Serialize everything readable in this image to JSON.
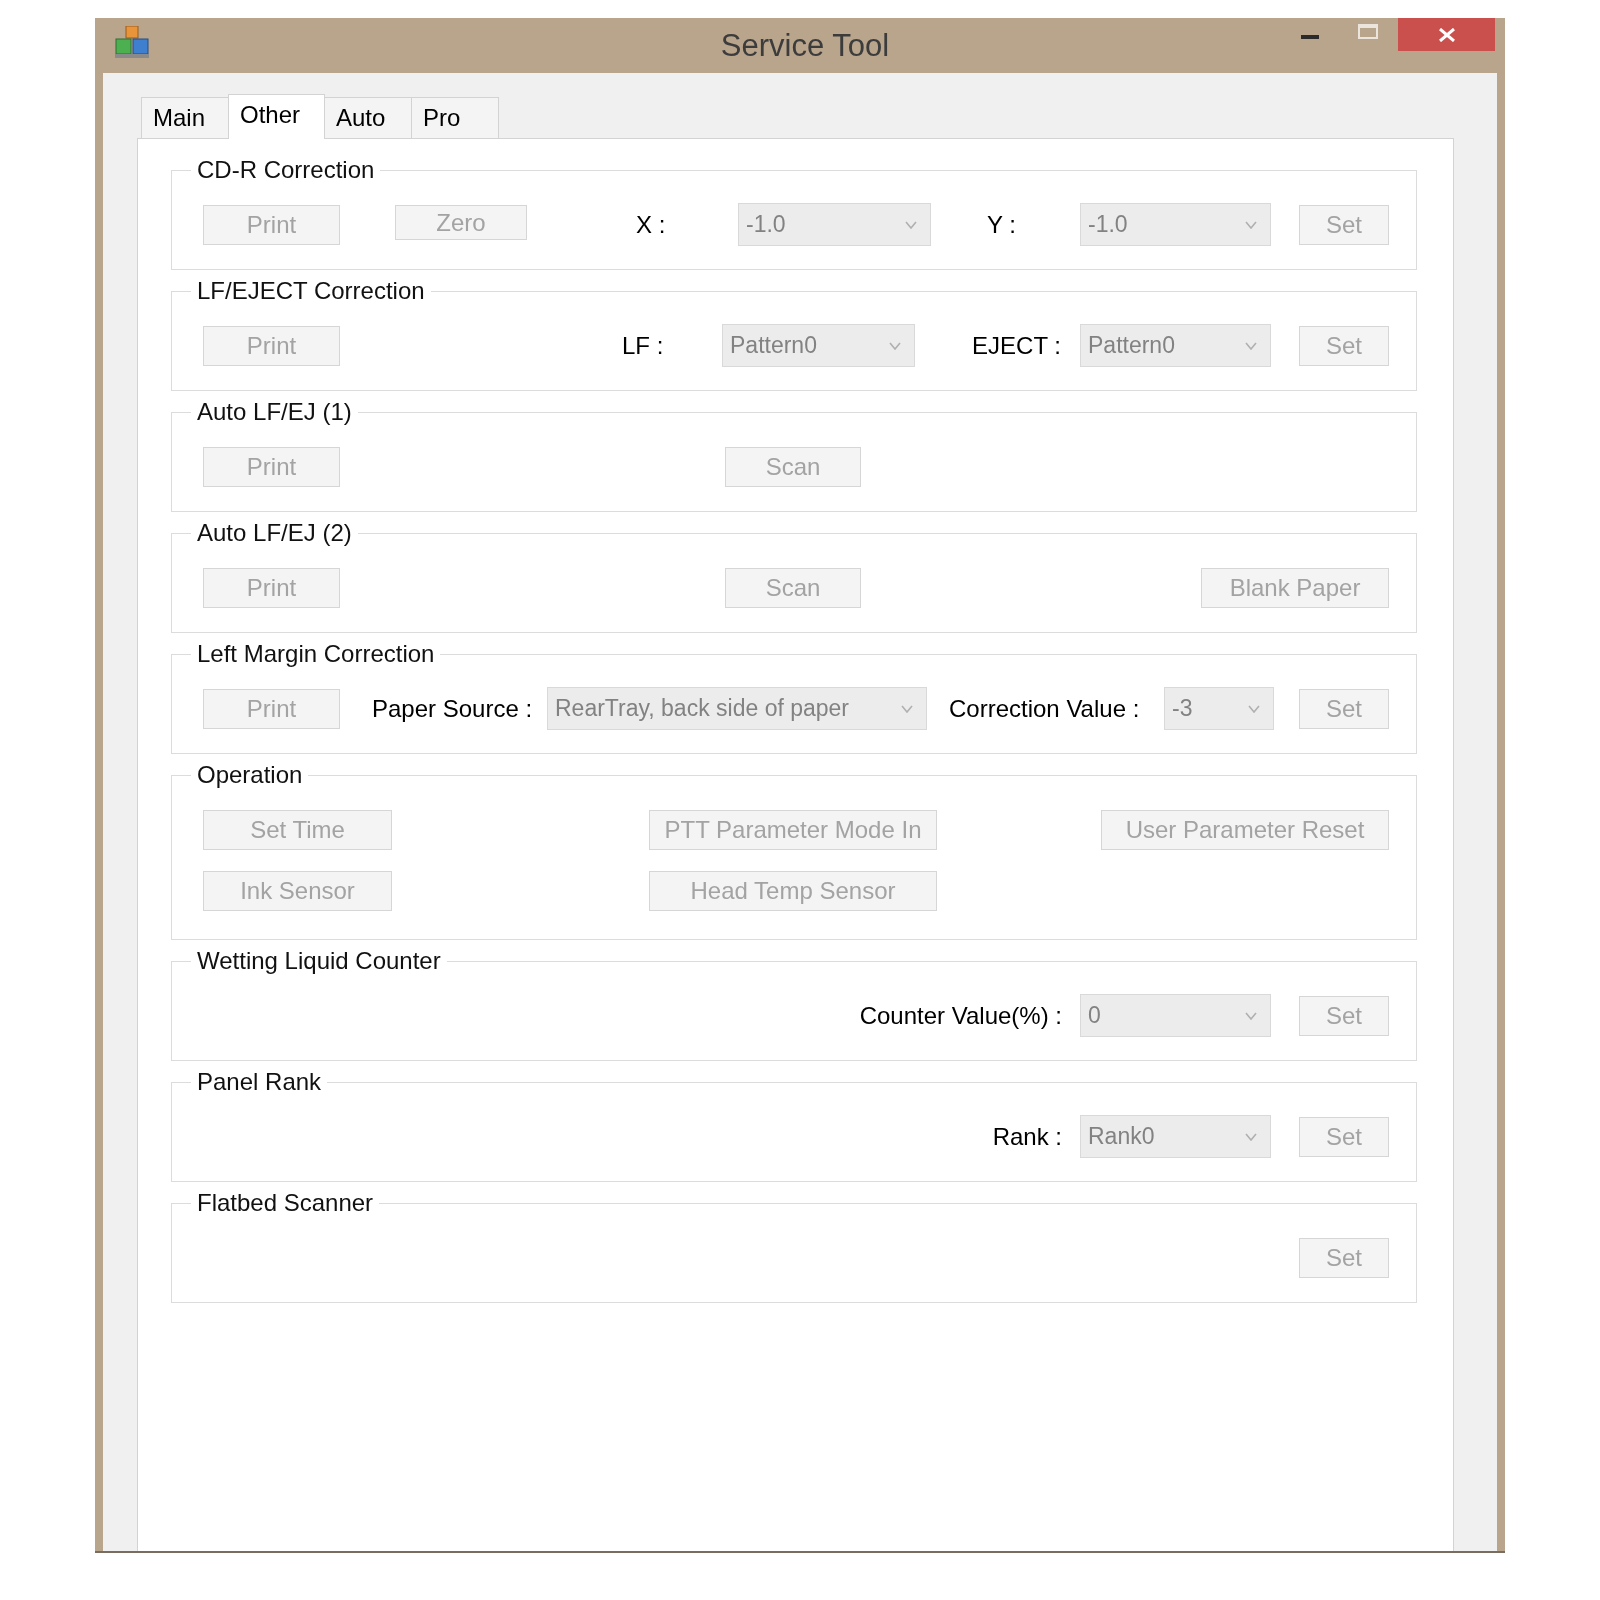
{
  "window": {
    "title": "Service Tool"
  },
  "tabs": [
    {
      "label": "Main",
      "selected": false
    },
    {
      "label": "Other",
      "selected": true
    },
    {
      "label": "Auto",
      "selected": false
    },
    {
      "label": "Pro",
      "selected": false
    }
  ],
  "groups": [
    {
      "title": "CD-R Correction",
      "rows": [
        [
          {
            "kind": "button",
            "label": "Print",
            "disabled": true
          },
          {
            "kind": "button",
            "label": "Zero",
            "disabled": true
          },
          {
            "kind": "label",
            "text": "X :"
          },
          {
            "kind": "dropdown",
            "value": "-1.0",
            "disabled": true
          },
          {
            "kind": "label",
            "text": "Y :"
          },
          {
            "kind": "dropdown",
            "value": "-1.0",
            "disabled": true
          },
          {
            "kind": "button",
            "label": "Set",
            "disabled": true
          }
        ]
      ]
    },
    {
      "title": "LF/EJECT Correction",
      "rows": [
        [
          {
            "kind": "button",
            "label": "Print",
            "disabled": true
          },
          {
            "kind": "label",
            "text": "LF :"
          },
          {
            "kind": "dropdown",
            "value": "Pattern0",
            "disabled": true
          },
          {
            "kind": "label",
            "text": "EJECT :"
          },
          {
            "kind": "dropdown",
            "value": "Pattern0",
            "disabled": true
          },
          {
            "kind": "button",
            "label": "Set",
            "disabled": true
          }
        ]
      ]
    },
    {
      "title": "Auto LF/EJ (1)",
      "rows": [
        [
          {
            "kind": "button",
            "label": "Print",
            "disabled": true
          },
          {
            "kind": "button",
            "label": "Scan",
            "disabled": true
          }
        ]
      ]
    },
    {
      "title": "Auto LF/EJ (2)",
      "rows": [
        [
          {
            "kind": "button",
            "label": "Print",
            "disabled": true
          },
          {
            "kind": "button",
            "label": "Scan",
            "disabled": true
          },
          {
            "kind": "button",
            "label": "Blank Paper",
            "disabled": true
          }
        ]
      ]
    },
    {
      "title": "Left Margin Correction",
      "rows": [
        [
          {
            "kind": "button",
            "label": "Print",
            "disabled": true
          },
          {
            "kind": "label",
            "text": "Paper Source :"
          },
          {
            "kind": "dropdown",
            "value": "RearTray, back side of paper",
            "disabled": true
          },
          {
            "kind": "label",
            "text": "Correction Value :"
          },
          {
            "kind": "dropdown",
            "value": "-3",
            "disabled": true
          },
          {
            "kind": "button",
            "label": "Set",
            "disabled": true
          }
        ]
      ]
    },
    {
      "title": "Operation",
      "rows": [
        [
          {
            "kind": "button",
            "label": "Set Time",
            "disabled": true
          },
          {
            "kind": "button",
            "label": "PTT Parameter Mode In",
            "disabled": true
          },
          {
            "kind": "button",
            "label": "User Parameter Reset",
            "disabled": true
          }
        ],
        [
          {
            "kind": "button",
            "label": "Ink Sensor",
            "disabled": true
          },
          {
            "kind": "button",
            "label": "Head Temp Sensor",
            "disabled": true
          }
        ]
      ]
    },
    {
      "title": "Wetting Liquid Counter",
      "rows": [
        [
          {
            "kind": "label",
            "text": "Counter Value(%) :"
          },
          {
            "kind": "dropdown",
            "value": "0",
            "disabled": true
          },
          {
            "kind": "button",
            "label": "Set",
            "disabled": true
          }
        ]
      ]
    },
    {
      "title": "Panel Rank",
      "rows": [
        [
          {
            "kind": "label",
            "text": "Rank :"
          },
          {
            "kind": "dropdown",
            "value": "Rank0",
            "disabled": true
          },
          {
            "kind": "button",
            "label": "Set",
            "disabled": true
          }
        ]
      ]
    },
    {
      "title": "Flatbed Scanner",
      "rows": [
        [
          {
            "kind": "button",
            "label": "Set",
            "disabled": true
          }
        ]
      ]
    }
  ]
}
